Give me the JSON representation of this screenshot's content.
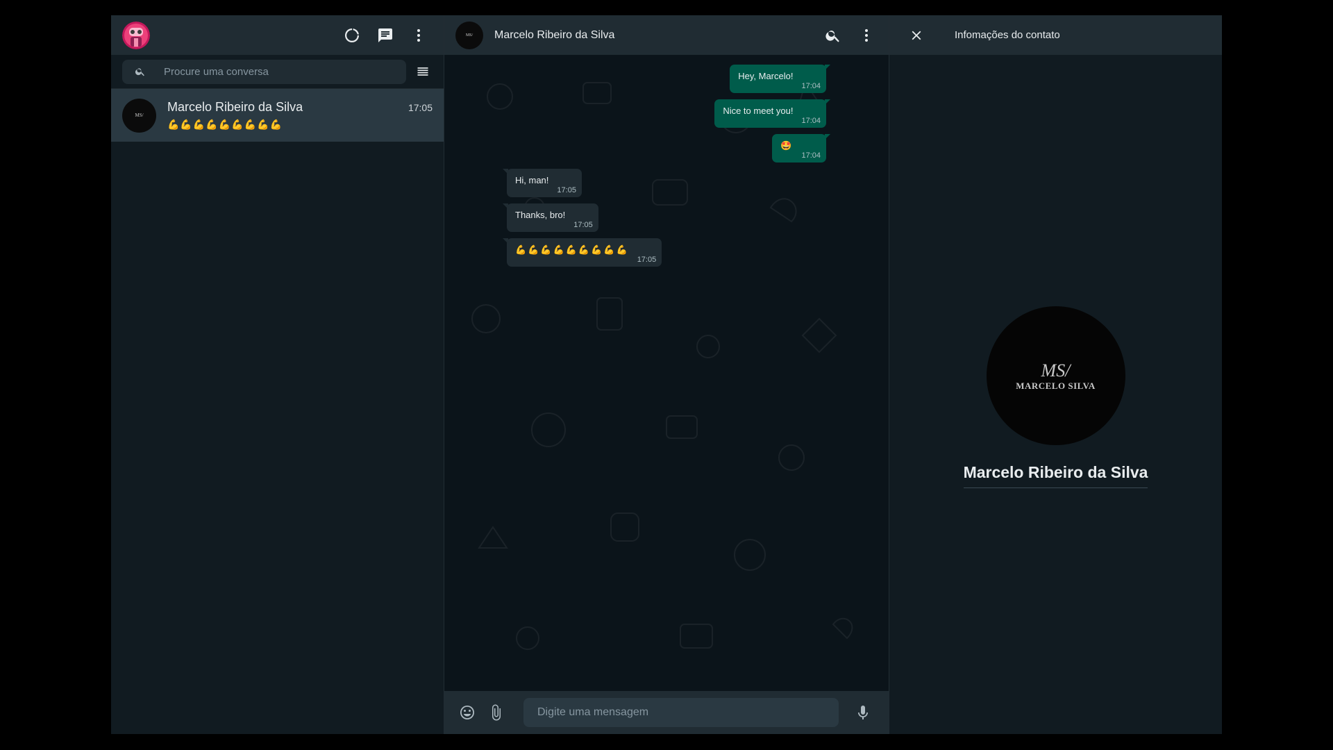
{
  "sidebar": {
    "search_placeholder": "Procure uma conversa",
    "chats": [
      {
        "name": "Marcelo Ribeiro da Silva",
        "time": "17:05",
        "preview": "💪💪💪💪💪💪💪💪💪"
      }
    ]
  },
  "chat": {
    "contact_name": "Marcelo Ribeiro da Silva",
    "input_placeholder": "Digite uma mensagem",
    "messages": [
      {
        "dir": "out",
        "text": "Hey, Marcelo!",
        "time": "17:04"
      },
      {
        "dir": "out",
        "text": "Nice to meet you!",
        "time": "17:04"
      },
      {
        "dir": "out",
        "text": "🤩",
        "time": "17:04"
      },
      {
        "dir": "in",
        "text": "Hi, man!",
        "time": "17:05"
      },
      {
        "dir": "in",
        "text": "Thanks, bro!",
        "time": "17:05"
      },
      {
        "dir": "in",
        "text": "💪💪💪💪💪💪💪💪💪",
        "time": "17:05"
      }
    ]
  },
  "info_panel": {
    "title": "Infomações do contato",
    "contact_name": "Marcelo Ribeiro da Silva",
    "logo_line1": "MS/",
    "logo_line2": "MARCELO SILVA"
  },
  "colors": {
    "outgoing_bubble": "#005c4b",
    "incoming_bubble": "#202c33",
    "header_bg": "#202c33",
    "app_bg": "#0b141a"
  },
  "icons": {
    "sidebar_header": [
      "status-icon",
      "new-chat-icon",
      "menu-icon"
    ],
    "chat_header": [
      "search-icon",
      "menu-icon"
    ],
    "footer": [
      "emoji-icon",
      "attach-icon",
      "mic-icon"
    ]
  }
}
